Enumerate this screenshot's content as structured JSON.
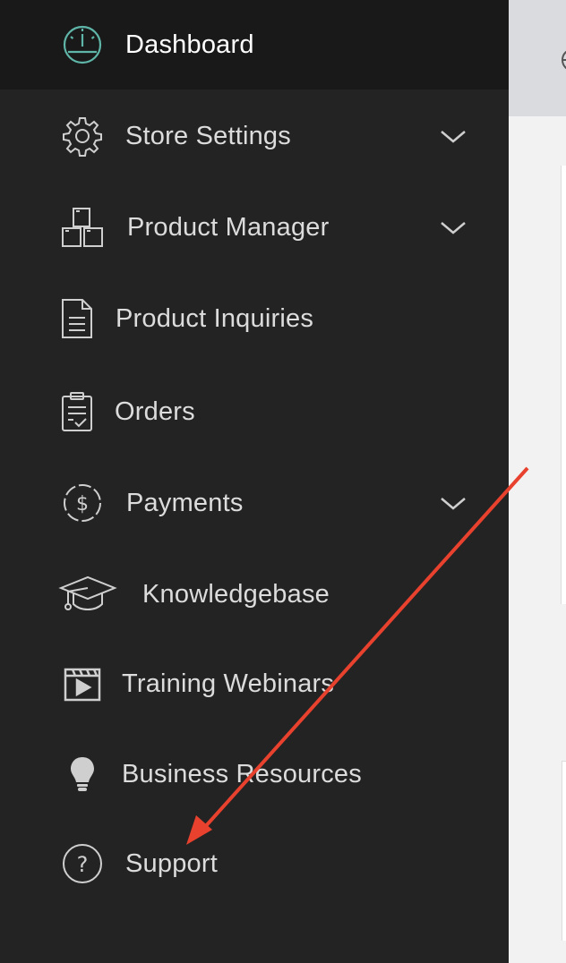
{
  "sidebar": {
    "items": [
      {
        "label": "Dashboard",
        "icon": "speedometer-icon",
        "active": true
      },
      {
        "label": "Store Settings",
        "icon": "gear-icon",
        "expandable": true
      },
      {
        "label": "Product Manager",
        "icon": "boxes-icon",
        "expandable": true
      },
      {
        "label": "Product Inquiries",
        "icon": "document-icon"
      },
      {
        "label": "Orders",
        "icon": "clipboard-icon"
      },
      {
        "label": "Payments",
        "icon": "dollar-circle-icon",
        "expandable": true
      },
      {
        "label": "Knowledgebase",
        "icon": "graduation-cap-icon"
      },
      {
        "label": "Training Webinars",
        "icon": "video-clapper-icon"
      },
      {
        "label": "Business Resources",
        "icon": "lightbulb-icon"
      },
      {
        "label": "Support",
        "icon": "question-circle-icon"
      }
    ]
  },
  "colors": {
    "sidebar_bg": "#232323",
    "active_bg": "#191919",
    "accent_teal": "#5fb5a8",
    "annotation_arrow": "#e8412e"
  }
}
